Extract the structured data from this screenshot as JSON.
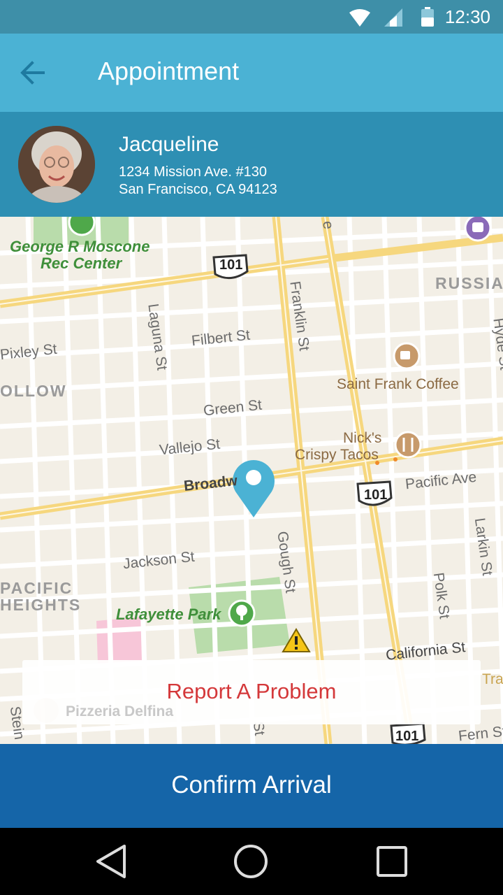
{
  "status_bar": {
    "time": "12:30"
  },
  "app_bar": {
    "title": "Appointment"
  },
  "client": {
    "name": "Jacqueline",
    "address_line1": "1234 Mission Ave. #130",
    "address_line2": "San Francisco, CA 94123"
  },
  "map": {
    "labels": {
      "moscone1": "George R Moscone",
      "moscone2": "Rec Center",
      "hwy_top": "101",
      "hwy_mid": "101",
      "hwy_bottom": "101",
      "laguna": "Laguna St",
      "franklin": "Franklin St",
      "russian": "RUSSIA",
      "hyde": "Hyde St",
      "filbert": "Filbert St",
      "pixley": "Pixley St",
      "hollow": "OLLOW",
      "saint_frank": "Saint Frank Coffee",
      "green": "Green St",
      "vallejo": "Vallejo St",
      "nicks1": "Nick's",
      "nicks2": "Crispy Tacos",
      "broadway": "Broadw",
      "pacific_ave": "Pacific Ave",
      "larkin": "Larkin St",
      "jackson": "Jackson St",
      "gough": "Gough St",
      "polk": "Polk St",
      "pacific1": "PACIFIC",
      "pacific2": "HEIGHTS",
      "lafayette": "Lafayette Park",
      "california": "California St",
      "fern": "Fern St",
      "pizzeria": "Pizzeria Delfina",
      "steiner": "Stein",
      "tra": "Tra",
      "partial_st": "St",
      "partial_e": "e"
    }
  },
  "report": {
    "label": "Report A Problem"
  },
  "confirm": {
    "label": "Confirm Arrival"
  },
  "colors": {
    "status_bar": "#3e8fa8",
    "app_bar": "#4bb2d4",
    "client_panel": "#2e8fb3",
    "confirm_button": "#1565a8",
    "report_text": "#d4383a",
    "pin": "#4bb2d4"
  }
}
